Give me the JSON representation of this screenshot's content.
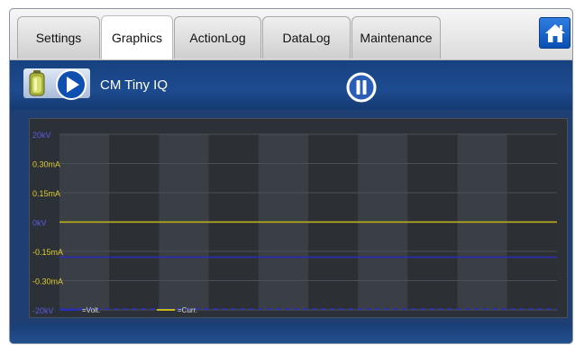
{
  "tabs": [
    {
      "label": "Settings"
    },
    {
      "label": "Graphics"
    },
    {
      "label": "ActionLog"
    },
    {
      "label": "DataLog"
    },
    {
      "label": "Maintenance"
    }
  ],
  "active_tab": "Graphics",
  "toolbar": {
    "device_name": "CM Tiny IQ"
  },
  "colors": {
    "tab_bg": "#dcdcdc",
    "window_bg": "#1f3f73",
    "plot_bg": "#3a3f45",
    "plot_band_dark": "#2c3035",
    "voltage": "#2b2db8",
    "current": "#c8b818",
    "axis_label_volt": "#5a5ae0",
    "axis_label_curr": "#e0cc30"
  },
  "icons": {
    "home": "home-icon",
    "battery": "battery-icon",
    "play": "play-icon",
    "pause": "pause-icon"
  },
  "chart_data": {
    "type": "line",
    "y_tick_labels": [
      "20kV",
      "0.30mA",
      "0.15mA",
      "0kV",
      "-0.15mA",
      "-0.30mA",
      "-20kV"
    ],
    "y_tick_kinds": [
      "volt",
      "curr",
      "curr",
      "volt",
      "curr",
      "curr",
      "volt"
    ],
    "ylim_curr_mA": [
      -0.45,
      0.45
    ],
    "ylim_volt_kV": [
      -20,
      20
    ],
    "time_divisions": 10,
    "series": [
      {
        "name": "=Volt.",
        "unit": "kV",
        "x": [
          0,
          10
        ],
        "values": [
          -8,
          -8
        ]
      },
      {
        "name": "=Curr.",
        "unit": "mA",
        "x": [
          0,
          10
        ],
        "values": [
          0,
          0
        ]
      }
    ],
    "legend": "bottom-left",
    "grid": true
  }
}
